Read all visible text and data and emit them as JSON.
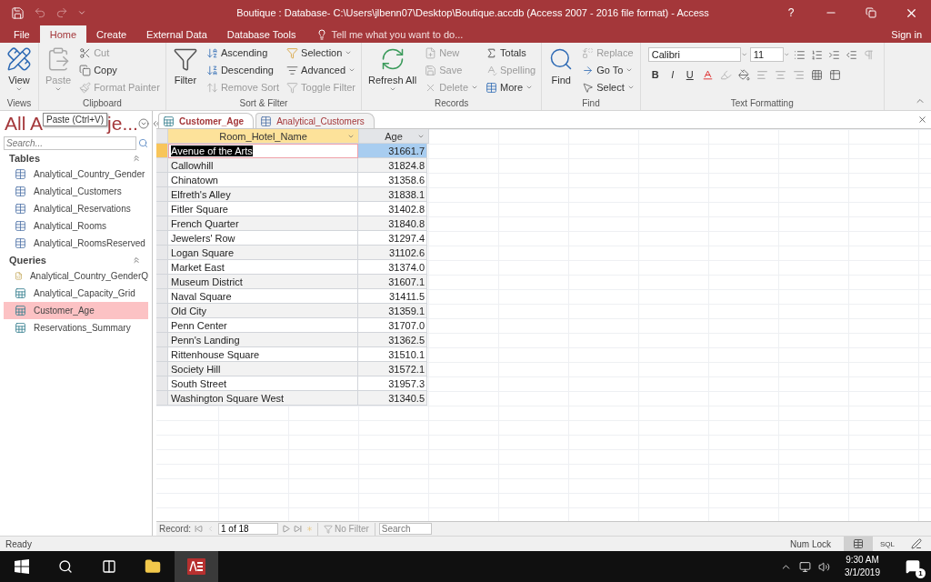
{
  "title_bar": {
    "title": "Boutique : Database- C:\\Users\\jlbenn07\\Desktop\\Boutique.accdb (Access 2007 - 2016 file format) - Access",
    "help": "?"
  },
  "ribbon_tabs": [
    {
      "label": "File",
      "selected": false
    },
    {
      "label": "Home",
      "selected": true
    },
    {
      "label": "Create",
      "selected": false
    },
    {
      "label": "External Data",
      "selected": false
    },
    {
      "label": "Database Tools",
      "selected": false
    }
  ],
  "tell_me": {
    "placeholder": "Tell me what you want to do..."
  },
  "sign_in": "Sign in",
  "ribbon_groups": [
    {
      "label": "Views",
      "commands": [
        {
          "label": "View",
          "kind": "large",
          "disabled": false,
          "dropdown": true
        }
      ]
    },
    {
      "label": "Clipboard",
      "commands": [
        {
          "label": "Paste",
          "kind": "large",
          "disabled": true,
          "dropdown": true
        },
        {
          "label": "Cut",
          "kind": "small",
          "disabled": true,
          "dropdown": false
        },
        {
          "label": "Copy",
          "kind": "small",
          "disabled": false,
          "dropdown": false
        },
        {
          "label": "Format Painter",
          "kind": "small",
          "disabled": true,
          "dropdown": false
        }
      ]
    },
    {
      "label": "Sort & Filter",
      "commands": [
        {
          "label": "Filter",
          "kind": "large",
          "disabled": false,
          "dropdown": false
        },
        {
          "label": "Ascending",
          "kind": "small",
          "disabled": false,
          "dropdown": false
        },
        {
          "label": "Descending",
          "kind": "small",
          "disabled": false,
          "dropdown": false
        },
        {
          "label": "Remove Sort",
          "kind": "small",
          "disabled": true,
          "dropdown": false
        },
        {
          "label": "Selection",
          "kind": "small",
          "disabled": false,
          "dropdown": true
        },
        {
          "label": "Advanced",
          "kind": "small",
          "disabled": false,
          "dropdown": true
        },
        {
          "label": "Toggle Filter",
          "kind": "small",
          "disabled": true,
          "dropdown": false
        }
      ]
    },
    {
      "label": "Records",
      "commands": [
        {
          "label": "Refresh All",
          "kind": "large",
          "disabled": false,
          "dropdown": true
        },
        {
          "label": "New",
          "kind": "small",
          "disabled": true,
          "dropdown": false
        },
        {
          "label": "Save",
          "kind": "small",
          "disabled": true,
          "dropdown": false
        },
        {
          "label": "Delete",
          "kind": "small",
          "disabled": true,
          "dropdown": true
        },
        {
          "label": "Totals",
          "kind": "small",
          "disabled": false,
          "dropdown": false
        },
        {
          "label": "Spelling",
          "kind": "small",
          "disabled": true,
          "dropdown": false
        },
        {
          "label": "More",
          "kind": "small",
          "disabled": false,
          "dropdown": true
        }
      ]
    },
    {
      "label": "Find",
      "commands": [
        {
          "label": "Find",
          "kind": "large",
          "disabled": false,
          "dropdown": false
        },
        {
          "label": "Replace",
          "kind": "small",
          "disabled": true,
          "dropdown": false
        },
        {
          "label": "Go To",
          "kind": "small",
          "disabled": false,
          "dropdown": true
        },
        {
          "label": "Select",
          "kind": "small",
          "disabled": false,
          "dropdown": true
        }
      ]
    }
  ],
  "text_formatting": {
    "label": "Text Formatting",
    "font": "Calibri",
    "size": "11",
    "styles": [
      "B",
      "I",
      "U"
    ]
  },
  "nav_pane": {
    "title_start": "All A",
    "tooltip": "Paste (Ctrl+V)",
    "title_end": "je...",
    "search": {
      "placeholder": "Search..."
    },
    "groups": [
      {
        "label": "Tables",
        "expanded": true,
        "items": [
          {
            "label": "Analytical_Country_Gender",
            "kind": "table",
            "selected": false
          },
          {
            "label": "Analytical_Customers",
            "kind": "table",
            "selected": false
          },
          {
            "label": "Analytical_Reservations",
            "kind": "table",
            "selected": false
          },
          {
            "label": "Analytical_Rooms",
            "kind": "table",
            "selected": false
          },
          {
            "label": "Analytical_RoomsReserved",
            "kind": "table",
            "selected": false
          }
        ]
      },
      {
        "label": "Queries",
        "expanded": true,
        "items": [
          {
            "label": "Analytical_Country_GenderQ",
            "kind": "param_query",
            "selected": false
          },
          {
            "label": "Analytical_Capacity_Grid",
            "kind": "query",
            "selected": false
          },
          {
            "label": "Customer_Age",
            "kind": "query",
            "selected": true
          },
          {
            "label": "Reservations_Summary",
            "kind": "query",
            "selected": false
          }
        ]
      }
    ]
  },
  "doc_tabs": [
    {
      "label": "Customer_Age",
      "kind": "query",
      "selected": true
    },
    {
      "label": "Analytical_Customers",
      "kind": "table",
      "selected": false
    }
  ],
  "table": {
    "columns": [
      {
        "label": "Room_Hotel_Name",
        "selected": true
      },
      {
        "label": "Age",
        "selected": false
      }
    ],
    "rows": [
      {
        "cells": [
          "Avenue of the Arts",
          "31661.7"
        ],
        "selected": true
      },
      {
        "cells": [
          "Callowhill",
          "31824.8"
        ],
        "selected": false
      },
      {
        "cells": [
          "Chinatown",
          "31358.6"
        ],
        "selected": false
      },
      {
        "cells": [
          "Elfreth's Alley",
          "31838.1"
        ],
        "selected": false
      },
      {
        "cells": [
          "Fitler Square",
          "31402.8"
        ],
        "selected": false
      },
      {
        "cells": [
          "French Quarter",
          "31840.8"
        ],
        "selected": false
      },
      {
        "cells": [
          "Jewelers' Row",
          "31297.4"
        ],
        "selected": false
      },
      {
        "cells": [
          "Logan Square",
          "31102.6"
        ],
        "selected": false
      },
      {
        "cells": [
          "Market East",
          "31374.0"
        ],
        "selected": false
      },
      {
        "cells": [
          "Museum District",
          "31607.1"
        ],
        "selected": false
      },
      {
        "cells": [
          "Naval Square",
          "31411.5"
        ],
        "selected": false
      },
      {
        "cells": [
          "Old City",
          "31359.1"
        ],
        "selected": false
      },
      {
        "cells": [
          "Penn Center",
          "31707.0"
        ],
        "selected": false
      },
      {
        "cells": [
          "Penn's Landing",
          "31362.5"
        ],
        "selected": false
      },
      {
        "cells": [
          "Rittenhouse Square",
          "31510.1"
        ],
        "selected": false
      },
      {
        "cells": [
          "Society Hill",
          "31572.1"
        ],
        "selected": false
      },
      {
        "cells": [
          "South Street",
          "31957.3"
        ],
        "selected": false
      },
      {
        "cells": [
          "Washington Square West",
          "31340.5"
        ],
        "selected": false
      }
    ]
  },
  "record_nav": {
    "label": "Record:",
    "position": "1 of 18",
    "filter": "No Filter",
    "search": {
      "placeholder": "Search"
    }
  },
  "status_bar": {
    "text": "Ready",
    "num_lock": "Num Lock",
    "views": [
      {
        "kind": "datasheet",
        "selected": true
      },
      {
        "kind": "sql",
        "label": "SQL",
        "selected": false
      },
      {
        "kind": "design",
        "selected": false
      }
    ]
  },
  "taskbar": {
    "time": "9:30 AM",
    "date": "3/1/2019",
    "notifications": "1"
  }
}
